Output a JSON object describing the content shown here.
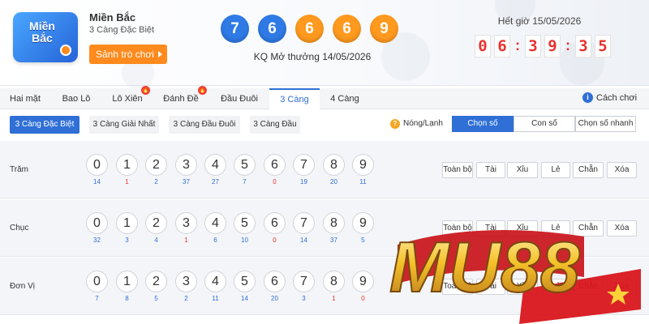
{
  "header": {
    "logo_text": "Miền Bắc",
    "lottery_name": "Miền Bắc",
    "lottery_sub": "3 Càng Đặc Biệt",
    "play_label": "Sảnh trò chơi",
    "result_balls": [
      "7",
      "6",
      "6",
      "6",
      "9"
    ],
    "ball_colors": [
      "#2f7ae5",
      "#2f7ae5",
      "#ff9a1f",
      "#ff9a1f",
      "#ff9a1f"
    ],
    "result_date": "KQ Mở thưởng 14/05/2026",
    "timer_label": "Hết giờ 15/05/2026",
    "timer_digits": [
      "0",
      "6",
      ":",
      "3",
      "9",
      ":",
      "3",
      "5"
    ]
  },
  "tabs": [
    {
      "label": "Hai mặt",
      "badge": ""
    },
    {
      "label": "Bao Lô",
      "badge": ""
    },
    {
      "label": "Lô Xiên",
      "badge": "🔥"
    },
    {
      "label": "Đánh Đề",
      "badge": "🔥"
    },
    {
      "label": "Đầu Đuôi",
      "badge": ""
    },
    {
      "label": "3 Càng",
      "badge": ""
    },
    {
      "label": "4 Càng",
      "badge": ""
    }
  ],
  "help_label": "Cách chơi",
  "subtabs": [
    "3 Càng Đặc Biệt",
    "3 Càng Giải Nhất",
    "3 Càng Đầu Đuôi",
    "3 Càng Đầu"
  ],
  "hot_cold_label": "Nóng/Lạnh",
  "modes": [
    "Chọn số",
    "Con số",
    "Chọn số nhanh"
  ],
  "digits": [
    "0",
    "1",
    "2",
    "3",
    "4",
    "5",
    "6",
    "7",
    "8",
    "9"
  ],
  "quick_buttons": [
    "Toàn bộ",
    "Tài",
    "Xỉu",
    "Lẻ",
    "Chẵn",
    "Xóa"
  ],
  "rows": [
    {
      "label": "Trăm",
      "stats": [
        "14",
        "1",
        "2",
        "37",
        "27",
        "7",
        "0",
        "19",
        "20",
        "11"
      ]
    },
    {
      "label": "Chục",
      "stats": [
        "32",
        "3",
        "4",
        "1",
        "6",
        "10",
        "0",
        "14",
        "37",
        "5"
      ]
    },
    {
      "label": "Đơn Vị",
      "stats": [
        "7",
        "8",
        "5",
        "2",
        "11",
        "14",
        "20",
        "3",
        "1",
        "0"
      ]
    }
  ],
  "watermark_text": "MU88",
  "colors": {
    "accent": "#2f6fd6",
    "orange": "#ff8a1d",
    "red": "#e8322f"
  }
}
